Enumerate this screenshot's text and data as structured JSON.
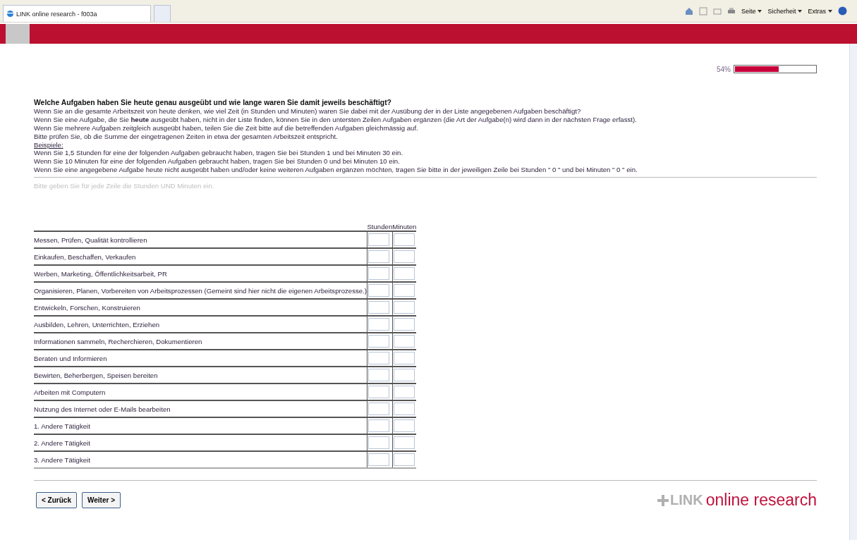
{
  "browser": {
    "tab_title": "LINK online research - f003a",
    "toolbar": [
      "Seite",
      "Sicherheit",
      "Extras"
    ]
  },
  "progress": {
    "reading": "54%",
    "level": 0.54
  },
  "question": {
    "title": "Welche Aufgaben haben Sie heute genau ausgeübt und wie lange waren Sie damit jeweils beschäftigt?",
    "lines": [
      "Wenn Sie an die gesamte Arbeitszeit von heute denken, wie viel Zeit (in Stunden und Minuten) waren Sie dabei mit der Ausübung der in der Liste angegebenen Aufgaben beschäftigt?",
      "Wenn Sie eine Aufgabe, die Sie **heute** ausgeübt haben, nicht in der Liste finden, können Sie in den untersten Zeilen Aufgaben ergänzen (die Art der Aufgabe(n) wird dann in der nächsten Frage erfasst).",
      "Wenn Sie mehrere Aufgaben zeitgleich ausgeübt haben, teilen Sie die Zeit bitte auf die betreffenden Aufgaben gleichmässig auf.",
      "Bitte prüfen Sie, ob die Summe der eingetragenen Zeiten in etwa der gesamten Arbeitszeit entspricht."
    ],
    "examples_heading": "Beispiele:",
    "examples": [
      "Wenn Sie 1,5 Stunden für eine der folgenden Aufgaben gebraucht haben, tragen Sie bei Stunden 1 und bei Minuten 30 ein.",
      "Wenn Sie 10 Minuten für eine der folgenden Aufgaben gebraucht haben, tragen Sie bei Stunden 0 und bei Minuten 10 ein.",
      "Wenn Sie eine angegebene Aufgabe heute nicht ausgeübt haben und/oder keine weiteren Aufgaben ergänzen möchten, tragen Sie bitte in der jeweiligen Zeile bei Stunden \" 0 \" und bei Minuten \" 0 \" ein."
    ]
  },
  "hint": "Bitte geben Sie für jede Zeile die Stunden UND Minuten ein.",
  "table": {
    "columns": [
      "Stunden",
      "Minuten"
    ],
    "rows": [
      {
        "label": "Messen, Prüfen, Qualität kontrollieren"
      },
      {
        "label": "Einkaufen, Beschaffen, Verkaufen"
      },
      {
        "label": "Werben, Marketing, Öffentlichkeitsarbeit, PR"
      },
      {
        "label": "Organisieren, Planen, Vorbereiten von Arbeitsprozessen (Gemeint sind hier nicht die eigenen Arbeitsprozesse.)"
      },
      {
        "label": "Entwickeln, Forschen, Konstruieren"
      },
      {
        "label": "Ausbilden, Lehren, Unterrichten, Erziehen"
      },
      {
        "label": "Informationen sammeln, Recherchieren, Dokumentieren"
      },
      {
        "label": "Beraten und Informieren"
      },
      {
        "label": "Bewirten, Beherbergen, Speisen bereiten"
      },
      {
        "label": "Arbeiten mit Computern"
      },
      {
        "label": "Nutzung des Internet oder E-Mails bearbeiten"
      },
      {
        "label": "1. Andere Tätigkeit"
      },
      {
        "label": "2. Andere Tätigkeit"
      },
      {
        "label": "3. Andere Tätigkeit"
      }
    ]
  },
  "buttons": [
    {
      "label": "< Zurück"
    },
    {
      "label": "Weiter >"
    }
  ],
  "logo": {
    "brand": "LINK",
    "tagline": "online research"
  }
}
